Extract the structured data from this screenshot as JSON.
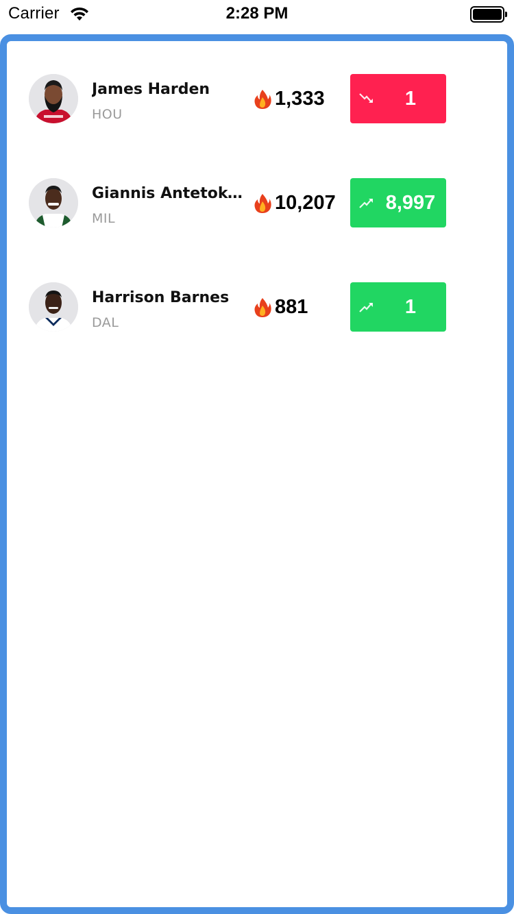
{
  "status_bar": {
    "carrier": "Carrier",
    "time": "2:28 PM"
  },
  "colors": {
    "frame_border": "#4a90e2",
    "down": "#ff2150",
    "up": "#21d662",
    "team_text": "#9a9a9a"
  },
  "players": [
    {
      "name": "James Harden",
      "team": "HOU",
      "score": "1,333",
      "change": "1",
      "trend": "down",
      "trend_icon": "trending-down-icon",
      "score_icon": "fire-icon"
    },
    {
      "name": "Giannis Antetokounmpo",
      "team": "MIL",
      "score": "10,207",
      "change": "8,997",
      "trend": "up",
      "trend_icon": "trending-up-icon",
      "score_icon": "fire-icon"
    },
    {
      "name": "Harrison Barnes",
      "team": "DAL",
      "score": "881",
      "change": "1",
      "trend": "up",
      "trend_icon": "trending-up-icon",
      "score_icon": "fire-icon"
    }
  ]
}
